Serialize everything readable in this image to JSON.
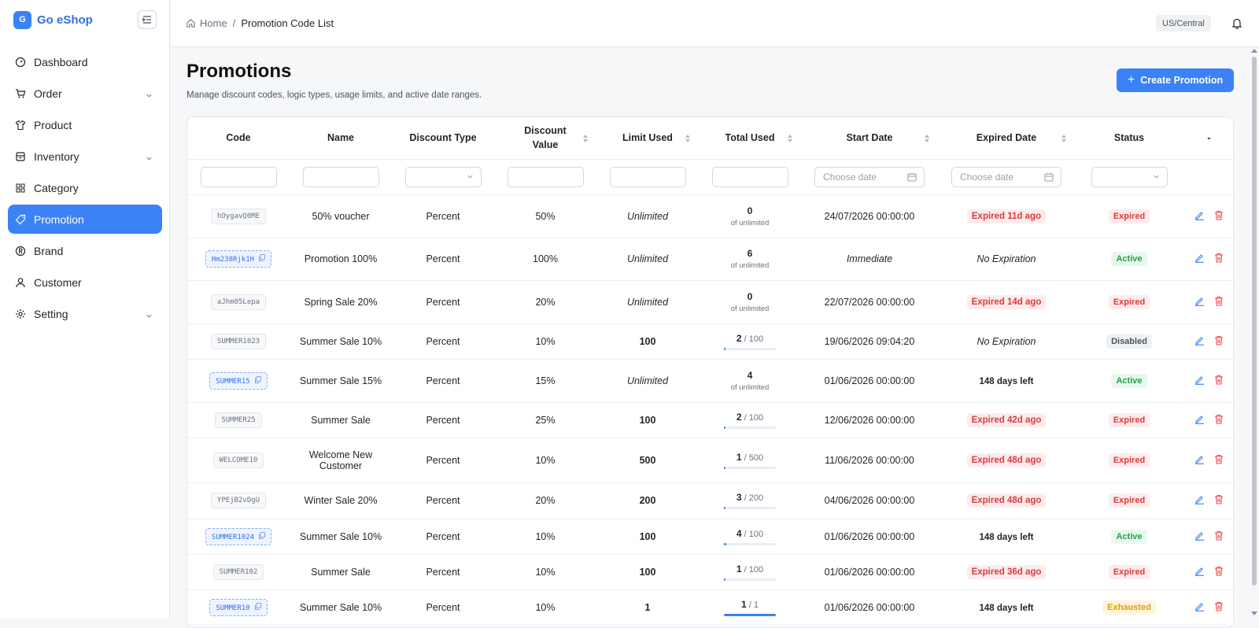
{
  "app": {
    "logo_letter": "G",
    "name": "Go eShop"
  },
  "sidebar": {
    "items": [
      {
        "label": "Dashboard",
        "icon": "gauge-icon",
        "expandable": false,
        "active": false
      },
      {
        "label": "Order",
        "icon": "cart-icon",
        "expandable": true,
        "active": false
      },
      {
        "label": "Product",
        "icon": "shirt-icon",
        "expandable": false,
        "active": false
      },
      {
        "label": "Inventory",
        "icon": "box-icon",
        "expandable": true,
        "active": false
      },
      {
        "label": "Category",
        "icon": "grid-icon",
        "expandable": false,
        "active": false
      },
      {
        "label": "Promotion",
        "icon": "tag-icon",
        "expandable": false,
        "active": true
      },
      {
        "label": "Brand",
        "icon": "registered-icon",
        "expandable": false,
        "active": false
      },
      {
        "label": "Customer",
        "icon": "user-icon",
        "expandable": false,
        "active": false
      },
      {
        "label": "Setting",
        "icon": "gear-icon",
        "expandable": true,
        "active": false
      }
    ]
  },
  "topbar": {
    "home": "Home",
    "separator": "/",
    "current": "Promotion Code List",
    "timezone": "US/Central"
  },
  "header": {
    "title": "Promotions",
    "subtitle": "Manage discount codes, logic types, usage limits, and active date ranges.",
    "create_label": "Create Promotion"
  },
  "table": {
    "columns": {
      "code": "Code",
      "name": "Name",
      "discount_type": "Discount Type",
      "discount_value_1": "Discount",
      "discount_value_2": "Value",
      "limit_used": "Limit Used",
      "total_used": "Total Used",
      "start_date": "Start Date",
      "expired_date": "Expired Date",
      "status": "Status",
      "actions": "-"
    },
    "filters": {
      "date_placeholder": "Choose date"
    },
    "rows": [
      {
        "code": "hOygavQ0ME",
        "code_active": false,
        "name": "50% voucher",
        "type": "Percent",
        "value": "50%",
        "limit": "Unlimited",
        "limit_unlimited": true,
        "used": "0",
        "used_limit": "",
        "used_sub": "of unlimited",
        "progress": 0,
        "start": "24/07/2026 00:00:00",
        "start_italic": false,
        "expire": "Expired 11d ago",
        "expire_kind": "expired",
        "status": "Expired",
        "status_kind": "expired"
      },
      {
        "code": "Hm238Rjk1H",
        "code_active": true,
        "name": "Promotion 100%",
        "type": "Percent",
        "value": "100%",
        "limit": "Unlimited",
        "limit_unlimited": true,
        "used": "6",
        "used_limit": "",
        "used_sub": "of unlimited",
        "progress": 0,
        "start": "Immediate",
        "start_italic": true,
        "expire": "No Expiration",
        "expire_kind": "none",
        "status": "Active",
        "status_kind": "active"
      },
      {
        "code": "aJhm05Lepa",
        "code_active": false,
        "name": "Spring Sale 20%",
        "type": "Percent",
        "value": "20%",
        "limit": "Unlimited",
        "limit_unlimited": true,
        "used": "0",
        "used_limit": "",
        "used_sub": "of unlimited",
        "progress": 0,
        "start": "22/07/2026 00:00:00",
        "start_italic": false,
        "expire": "Expired 14d ago",
        "expire_kind": "expired",
        "status": "Expired",
        "status_kind": "expired"
      },
      {
        "code": "SUMMER1023",
        "code_active": false,
        "name": "Summer Sale 10%",
        "type": "Percent",
        "value": "10%",
        "limit": "100",
        "limit_unlimited": false,
        "used": "2",
        "used_limit": "100",
        "used_sub": "",
        "progress": 0.02,
        "start": "19/06/2026 09:04:20",
        "start_italic": false,
        "expire": "No Expiration",
        "expire_kind": "none",
        "status": "Disabled",
        "status_kind": "disabled"
      },
      {
        "code": "SUMMER15",
        "code_active": true,
        "name": "Summer Sale 15%",
        "type": "Percent",
        "value": "15%",
        "limit": "Unlimited",
        "limit_unlimited": true,
        "used": "4",
        "used_limit": "",
        "used_sub": "of unlimited",
        "progress": 0,
        "start": "01/06/2026 00:00:00",
        "start_italic": false,
        "expire": "148 days left",
        "expire_kind": "left",
        "status": "Active",
        "status_kind": "active"
      },
      {
        "code": "SUMMER25",
        "code_active": false,
        "name": "Summer Sale",
        "type": "Percent",
        "value": "25%",
        "limit": "100",
        "limit_unlimited": false,
        "used": "2",
        "used_limit": "100",
        "used_sub": "",
        "progress": 0.02,
        "start": "12/06/2026 00:00:00",
        "start_italic": false,
        "expire": "Expired 42d ago",
        "expire_kind": "expired",
        "status": "Expired",
        "status_kind": "expired"
      },
      {
        "code": "WELCOME10",
        "code_active": false,
        "name": "Welcome New Customer",
        "type": "Percent",
        "value": "10%",
        "limit": "500",
        "limit_unlimited": false,
        "used": "1",
        "used_limit": "500",
        "used_sub": "",
        "progress": 0.002,
        "start": "11/06/2026 00:00:00",
        "start_italic": false,
        "expire": "Expired 48d ago",
        "expire_kind": "expired",
        "status": "Expired",
        "status_kind": "expired"
      },
      {
        "code": "YPEjB2vDgU",
        "code_active": false,
        "name": "Winter Sale 20%",
        "type": "Percent",
        "value": "20%",
        "limit": "200",
        "limit_unlimited": false,
        "used": "3",
        "used_limit": "200",
        "used_sub": "",
        "progress": 0.015,
        "start": "04/06/2026 00:00:00",
        "start_italic": false,
        "expire": "Expired 48d ago",
        "expire_kind": "expired",
        "status": "Expired",
        "status_kind": "expired"
      },
      {
        "code": "SUMMER1024",
        "code_active": true,
        "name": "Summer Sale 10%",
        "type": "Percent",
        "value": "10%",
        "limit": "100",
        "limit_unlimited": false,
        "used": "4",
        "used_limit": "100",
        "used_sub": "",
        "progress": 0.04,
        "start": "01/06/2026 00:00:00",
        "start_italic": false,
        "expire": "148 days left",
        "expire_kind": "left",
        "status": "Active",
        "status_kind": "active"
      },
      {
        "code": "SUMMER102",
        "code_active": false,
        "name": "Summer Sale",
        "type": "Percent",
        "value": "10%",
        "limit": "100",
        "limit_unlimited": false,
        "used": "1",
        "used_limit": "100",
        "used_sub": "",
        "progress": 0.01,
        "start": "01/06/2026 00:00:00",
        "start_italic": false,
        "expire": "Expired 36d ago",
        "expire_kind": "expired",
        "status": "Expired",
        "status_kind": "expired"
      },
      {
        "code": "SUMMER10",
        "code_active": true,
        "name": "Summer Sale 10%",
        "type": "Percent",
        "value": "10%",
        "limit": "1",
        "limit_unlimited": false,
        "used": "1",
        "used_limit": "1",
        "used_sub": "",
        "progress": 1,
        "start": "01/06/2026 00:00:00",
        "start_italic": false,
        "expire": "148 days left",
        "expire_kind": "left",
        "status": "Exhausted",
        "status_kind": "exhausted"
      }
    ]
  }
}
